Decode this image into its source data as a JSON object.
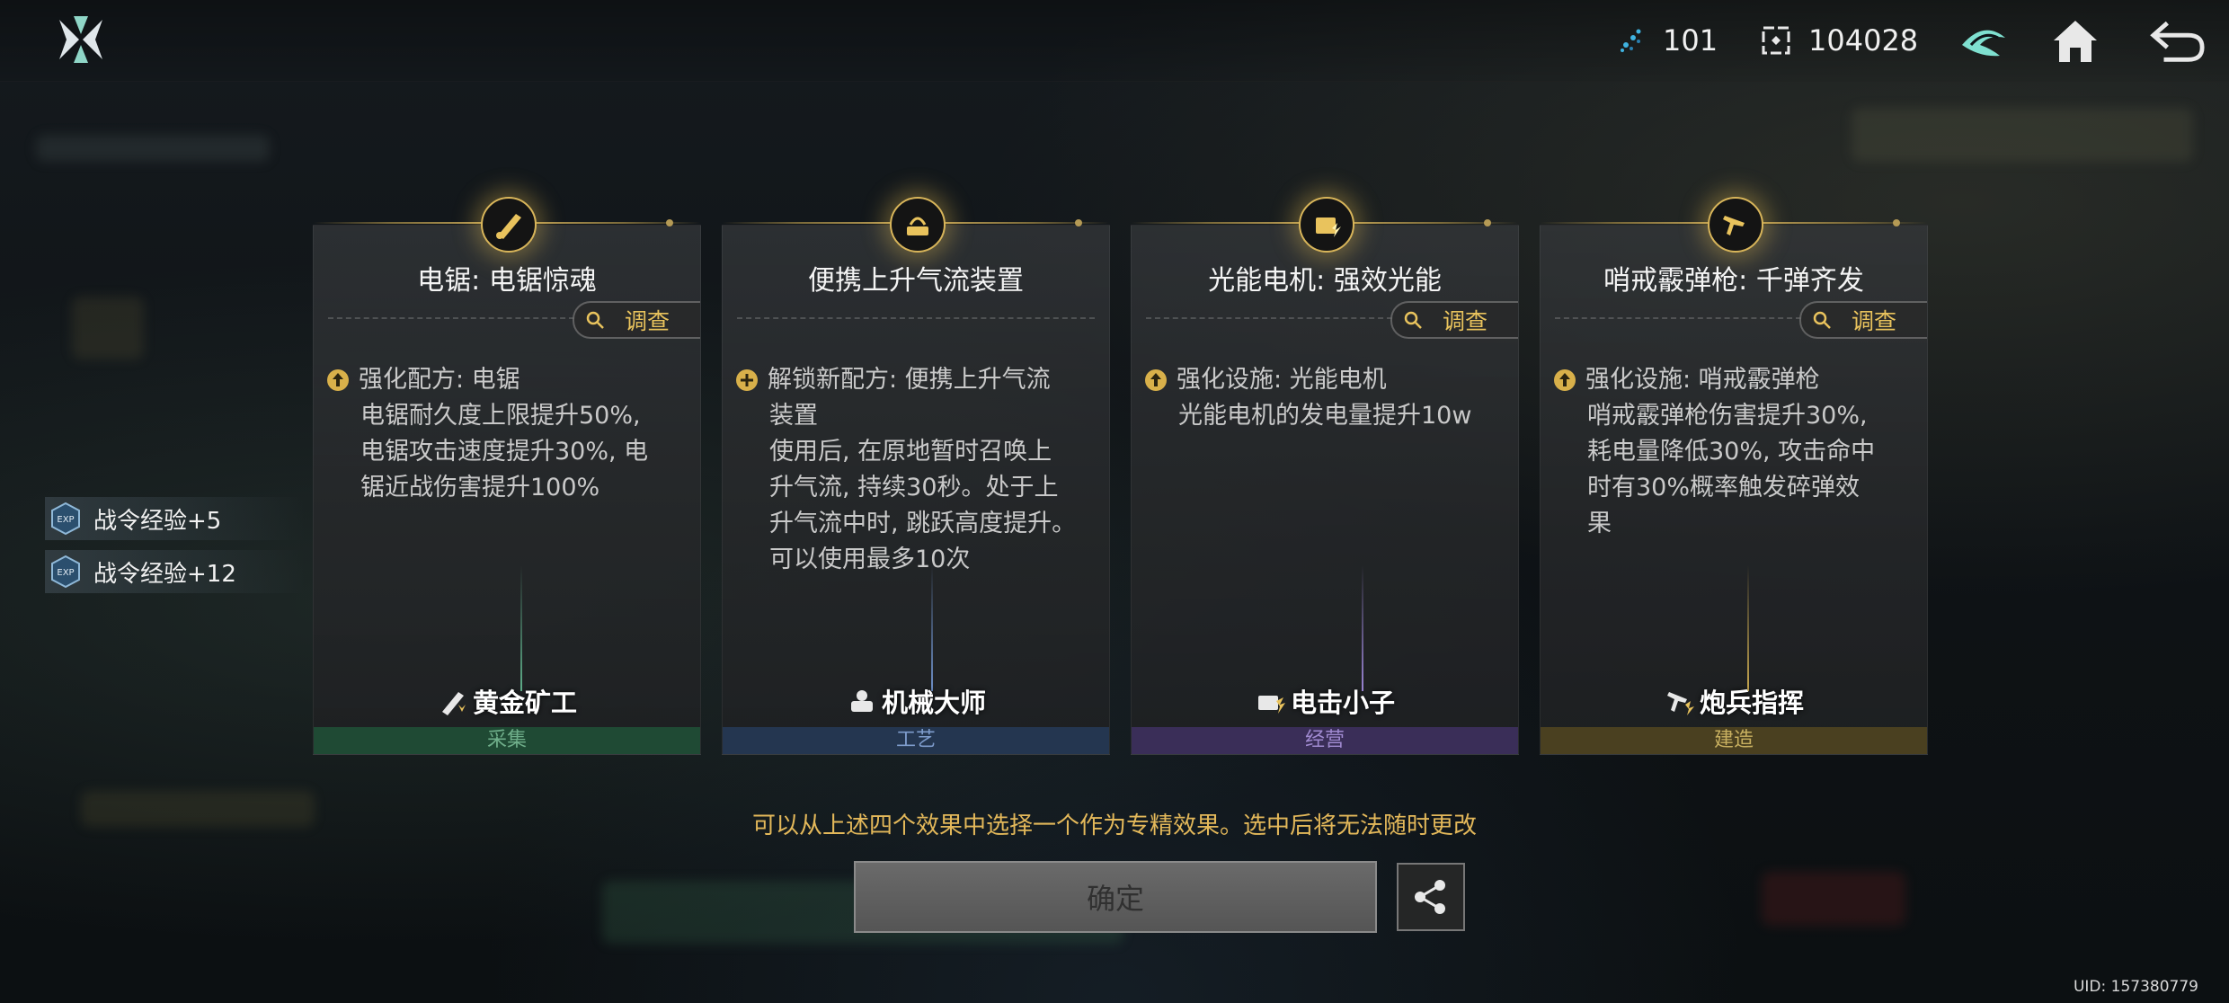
{
  "topbar": {
    "energy_value": "101",
    "currency_value": "104028"
  },
  "exp_list": [
    {
      "label": "战令经验+5"
    },
    {
      "label": "战令经验+12"
    }
  ],
  "cards": [
    {
      "title": "电锯: 电锯惊魂",
      "inspect_label": "调查",
      "effect_head": "强化配方: 电锯",
      "effect_body": "电锯耐久度上限提升50%,\n电锯攻击速度提升30%, 电\n锯近战伤害提升100%",
      "character": "黄金矿工",
      "category": "采集",
      "category_color": "#1f4a34",
      "category_text_color": "#6fae8a",
      "beam_color": "#5fae8a"
    },
    {
      "title": "便携上升气流装置",
      "inspect_label": "",
      "effect_head": "解锁新配方: 便携上升气流",
      "effect_body": "装置\n使用后, 在原地暂时召唤上\n升气流, 持续30秒。处于上\n升气流中时, 跳跃高度提升。\n可以使用最多10次",
      "character": "机械大师",
      "category": "工艺",
      "category_color": "#243650",
      "category_text_color": "#7e9ccc",
      "beam_color": "#6e90c8"
    },
    {
      "title": "光能电机: 强效光能",
      "inspect_label": "调查",
      "effect_head": "强化设施: 光能电机",
      "effect_body": "光能电机的发电量提升10w",
      "character": "电击小子",
      "category": "经营",
      "category_color": "#3a2e58",
      "category_text_color": "#a08ad0",
      "beam_color": "#9a84d4"
    },
    {
      "title": "哨戒霰弹枪: 千弹齐发",
      "inspect_label": "调查",
      "effect_head": "强化设施: 哨戒霰弹枪",
      "effect_body": "哨戒霰弹枪伤害提升30%,\n耗电量降低30%, 攻击命中\n时有30%概率触发碎弹效\n果",
      "character": "炮兵指挥",
      "category": "建造",
      "category_color": "#4a4020",
      "category_text_color": "#c8b060",
      "beam_color": "#c8a850"
    }
  ],
  "hint": "可以从上述四个效果中选择一个作为专精效果。选中后将无法随时更改",
  "confirm_label": "确定",
  "uid": "UID: 157380779",
  "colors": {
    "accent_gold": "#e9c35d",
    "bullet_gold": "#d8b04a"
  }
}
